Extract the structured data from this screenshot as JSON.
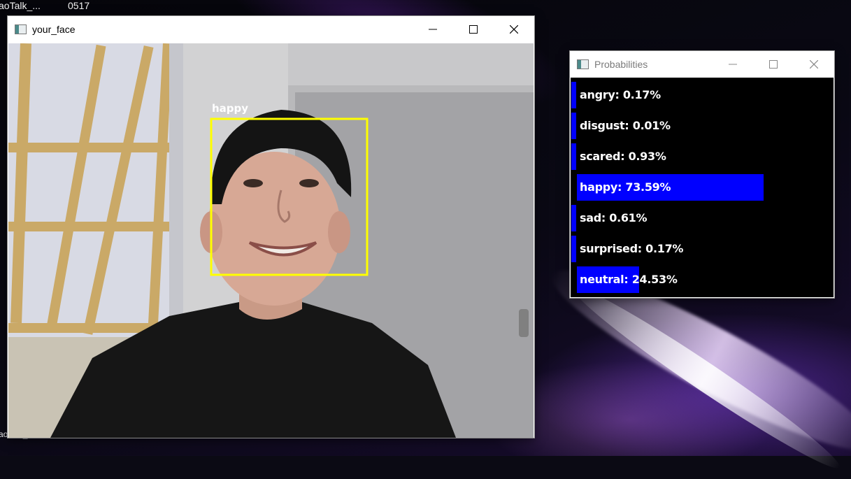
{
  "desktop": {
    "icons": [
      {
        "label": "aoTalk_..."
      },
      {
        "label": "0517"
      },
      {
        "label": "aoTalk_..."
      }
    ]
  },
  "face_window": {
    "title": "your_face",
    "detection_label": "happy",
    "box_color": "#ffff00"
  },
  "prob_window": {
    "title": "Probabilities",
    "bar_color": "#0000ff",
    "items": [
      {
        "label": "angry: 0.17%",
        "value": 0.17
      },
      {
        "label": "disgust: 0.01%",
        "value": 0.01
      },
      {
        "label": "scared: 0.93%",
        "value": 0.93
      },
      {
        "label": "happy: 73.59%",
        "value": 73.59
      },
      {
        "label": "sad: 0.61%",
        "value": 0.61
      },
      {
        "label": "surprised: 0.17%",
        "value": 0.17
      },
      {
        "label": "neutral: 24.53%",
        "value": 24.53
      }
    ]
  },
  "icons": {
    "minimize": "minimize-icon",
    "maximize": "maximize-icon",
    "close": "close-icon",
    "app": "app-window-icon"
  }
}
